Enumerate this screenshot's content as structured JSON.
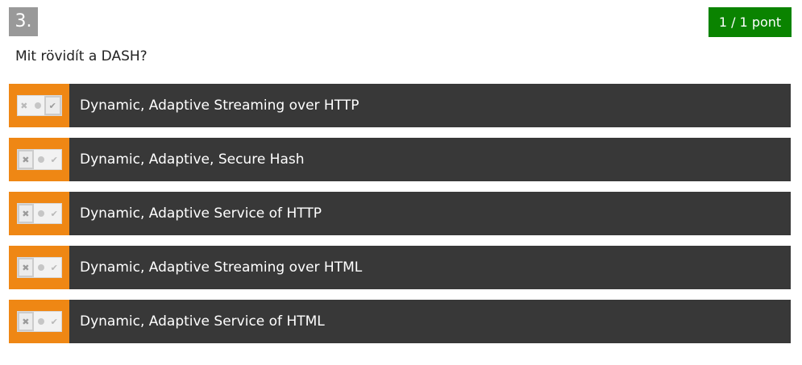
{
  "question": {
    "number": "3.",
    "score": "1 / 1 pont",
    "text": "Mit rövidít a DASH?"
  },
  "colors": {
    "score_badge": "#0a8300",
    "number_badge": "#999999",
    "tristate_bg": "#ef8714",
    "answer_bg": "#383838"
  },
  "answers": [
    {
      "label": "Dynamic, Adaptive Streaming over HTTP",
      "state": "true",
      "icons": [
        "x-icon",
        "dot-icon",
        "check-icon"
      ]
    },
    {
      "label": "Dynamic, Adaptive, Secure Hash",
      "state": "false",
      "icons": [
        "x-icon",
        "dot-icon",
        "check-icon"
      ]
    },
    {
      "label": "Dynamic, Adaptive Service of HTTP",
      "state": "false",
      "icons": [
        "x-icon",
        "dot-icon",
        "check-icon"
      ]
    },
    {
      "label": "Dynamic, Adaptive Streaming over HTML",
      "state": "false",
      "icons": [
        "x-icon",
        "dot-icon",
        "check-icon"
      ]
    },
    {
      "label": "Dynamic, Adaptive Service of HTML",
      "state": "false",
      "icons": [
        "x-icon",
        "dot-icon",
        "check-icon"
      ]
    }
  ]
}
